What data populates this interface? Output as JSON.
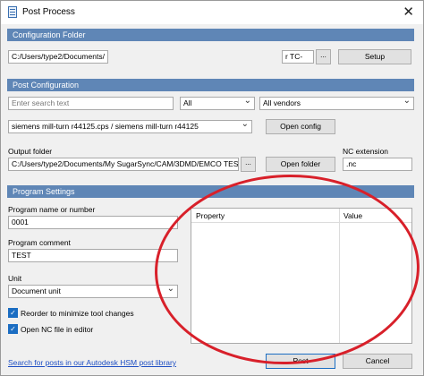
{
  "window": {
    "title": "Post Process",
    "close_glyph": "✕"
  },
  "configuration_folder": {
    "header": "Configuration Folder",
    "path_value": "C:/Users/type2/Documents/",
    "path_tail": "r TC-",
    "browse_label": "...",
    "setup_label": "Setup"
  },
  "post_configuration": {
    "header": "Post Configuration",
    "search_placeholder": "Enter search text",
    "filter_value": "All",
    "vendor_value": "All vendors",
    "post_value": "siemens mill-turn r44125.cps / siemens mill-turn r44125",
    "open_config_label": "Open config",
    "output_folder_label": "Output folder",
    "output_folder_value": "C:/Users/type2/Documents/My SugarSync/CAM/3DMD/EMCO TEST",
    "browse_label": "...",
    "open_folder_label": "Open folder",
    "nc_extension_label": "NC extension",
    "nc_extension_value": ".nc"
  },
  "program_settings": {
    "header": "Program Settings",
    "program_name_label": "Program name or number",
    "program_name_value": "0001",
    "program_comment_label": "Program comment",
    "program_comment_value": "TEST",
    "unit_label": "Unit",
    "unit_value": "Document unit",
    "reorder_label": "Reorder to minimize tool changes",
    "reorder_checked": true,
    "open_nc_label": "Open NC file in editor",
    "open_nc_checked": true,
    "check_glyph": "✓",
    "property_header": "Property",
    "value_header": "Value"
  },
  "footer": {
    "library_link": "Search for posts in our Autodesk HSM post library",
    "post_label": "Post",
    "cancel_label": "Cancel"
  },
  "colors": {
    "section_header": "#5f86b6",
    "annotation": "#d8202a",
    "link": "#1f4fc4"
  }
}
